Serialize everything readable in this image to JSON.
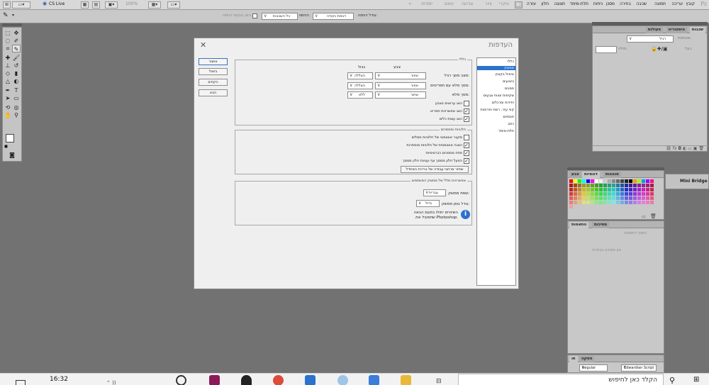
{
  "menubar": {
    "logo": "Ps",
    "items": [
      "קובץ",
      "עריכה",
      "תמונה",
      "שכבה",
      "בחירה",
      "מסנן",
      "ניתוח",
      "תלת-מימד",
      "תצוגה",
      "חלון",
      "עזרה"
    ],
    "workspaces": [
      "עיקרי",
      "ציור",
      "צביעה",
      "עיצוב",
      "יסודות"
    ],
    "workspace_button": "»",
    "cs_live": "CS Live",
    "zoom": "100%"
  },
  "optionsbar": {
    "size_label": "גודל דגימה:",
    "size_value": "דגימת נקודה",
    "sample_label": "דגימה:",
    "sample_value": "כל השכבות",
    "ring_label": "הצג טבעת דגימה"
  },
  "dialog": {
    "title": "העדפות",
    "close": "✕",
    "buttons": {
      "ok": "אישור",
      "cancel": "ביטול",
      "prev": "הקודם",
      "next": "הבא"
    },
    "categories": [
      "כללי",
      "ממשק",
      "טיפול בקובץ",
      "ביצועים",
      "סמנים",
      "שקיפות וטווח צבעים",
      "יחידות וסרגלים",
      "קווי עזר, רשת ופרוסות",
      "תוספים",
      "כתב",
      "תלת-מימד"
    ],
    "selected_category": 1,
    "general": {
      "title": "כללי",
      "col_color": "צבע",
      "col_border": "גבול",
      "rows": [
        {
          "label": "מצב מסך רגיל:",
          "color": "אפור",
          "border": "הצללה"
        },
        {
          "label": "מסך מלא עם תפריטים:",
          "color": "אפור",
          "border": "הצללה"
        },
        {
          "label": "מסך מלא:",
          "color": "שחור",
          "border": "ללא"
        }
      ],
      "checks": [
        {
          "label": "הצג ערוצים בצבע",
          "checked": false
        },
        {
          "label": "הצג אפשרויות תפריט",
          "checked": true
        },
        {
          "label": "הצג עצות כלים",
          "checked": true
        }
      ]
    },
    "panels": {
      "title": "חלוניות ומסמכים",
      "checks": [
        {
          "label": "מזעור אוטומטי של חלוניות סמלים",
          "checked": false
        },
        {
          "label": "הצגה אוטומטית של חלוניות מוסתרות",
          "checked": true
        },
        {
          "label": "פתח מסמכים ככרטיסיות",
          "checked": true
        },
        {
          "label": "הפעל חלון מסמך צף ועגינת חלון מסמך",
          "checked": true
        }
      ],
      "restore_button": "שחזר מרחבי עבודה של ברירת המחדל"
    },
    "ui_text": {
      "title": "אפשרויות מלל של ממשק המשתמש",
      "lang_label": "שפת ממשק:",
      "lang_value": "עברית",
      "size_label": "גודל גופן ממשק:",
      "size_value": "גדול",
      "note_line1": "השינויים יחולו בפעם הבאה",
      "note_line2": "שתפעיל את Photoshop."
    }
  },
  "panels": {
    "layers_tabs": [
      "שכבות",
      "היסטוריה",
      "פעולות"
    ],
    "layers_blend": "רגיל",
    "layers_opacity": "אטימות:",
    "layers_fill": "מילוי:",
    "layers_lock": "נעל:",
    "swatches_tabs": [
      "צבע",
      "דוגמיות",
      "סגנונות"
    ],
    "adjust_tabs": [
      "התאמות",
      "מסיכות"
    ],
    "adjust_title": "הוסף התאמה",
    "adjust_text": "אין מסיכה נבחרת",
    "minibridge": "Mini Bridge",
    "char_tabs": [
      "תו",
      "פסקה"
    ],
    "char_font": "Edwardian Script",
    "char_style": "Regular",
    "icon_color": "#2b72cc"
  },
  "taskbar": {
    "time": "16:32",
    "search_placeholder": "הקלד כאן לחיפוש"
  }
}
